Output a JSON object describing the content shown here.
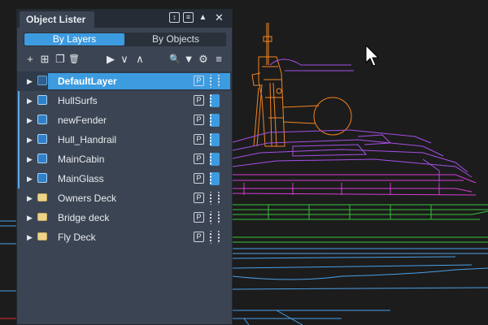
{
  "panel": {
    "title": "Object Lister",
    "titlebar_buttons": [
      {
        "icon": "sort-icon",
        "glyph": "↕"
      },
      {
        "icon": "list-icon",
        "glyph": "≡"
      },
      {
        "icon": "collapse-icon",
        "glyph": "▲"
      },
      {
        "icon": "close-icon",
        "glyph": "✕"
      }
    ],
    "modes": {
      "by_layers": "By Layers",
      "by_objects": "By Objects",
      "active": "by_layers"
    },
    "toolbar": [
      {
        "icon": "add-icon",
        "glyph": "+"
      },
      {
        "icon": "add-sublayer-icon",
        "glyph": "⊞"
      },
      {
        "icon": "copy-icon",
        "glyph": "❐"
      },
      {
        "icon": "delete-icon",
        "glyph": "🗑"
      },
      {
        "icon": "play-icon",
        "glyph": "▶"
      },
      {
        "icon": "chevron-down-icon",
        "glyph": "∨"
      },
      {
        "icon": "chevron-up-icon",
        "glyph": "∧"
      },
      {
        "icon": "search-icon",
        "glyph": "🔍"
      },
      {
        "icon": "filter-icon",
        "glyph": "▼"
      },
      {
        "icon": "gear-icon",
        "glyph": "⚙"
      },
      {
        "icon": "menu-icon",
        "glyph": "≡"
      }
    ],
    "layers": [
      {
        "name": "DefaultLayer",
        "kind": "layer",
        "selected": true,
        "current": false,
        "visible": false
      },
      {
        "name": "HullSurfs",
        "kind": "layer",
        "selected": false,
        "current": true,
        "visible": true
      },
      {
        "name": "newFender",
        "kind": "layer",
        "selected": false,
        "current": true,
        "visible": true
      },
      {
        "name": "Hull_Handrail",
        "kind": "layer",
        "selected": false,
        "current": true,
        "visible": true
      },
      {
        "name": "MainCabin",
        "kind": "layer",
        "selected": false,
        "current": true,
        "visible": true
      },
      {
        "name": "MainGlass",
        "kind": "layer",
        "selected": false,
        "current": true,
        "visible": true
      },
      {
        "name": "Owners Deck",
        "kind": "folder",
        "selected": false,
        "current": false,
        "visible": false
      },
      {
        "name": "Bridge deck",
        "kind": "folder",
        "selected": false,
        "current": false,
        "visible": false
      },
      {
        "name": "Fly Deck",
        "kind": "folder",
        "selected": false,
        "current": false,
        "visible": false
      }
    ],
    "p_label": "P",
    "expand_glyph": "▶"
  },
  "viewport": {
    "colors": {
      "background": "#1c1c1c",
      "orange": "#f5841f",
      "purple": "#a64fe6",
      "magenta": "#d63ad6",
      "green": "#35c43a",
      "blue": "#4aa0e8",
      "red": "#e03030"
    },
    "cursor_icon": "pointer-cursor-icon"
  }
}
